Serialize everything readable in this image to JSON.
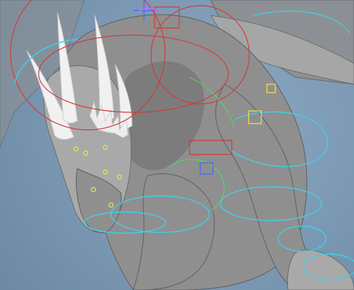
{
  "viewport": {
    "name": "3D viewport",
    "background_color": "#7f9cb6"
  },
  "scene": {
    "subject": "dragon-model",
    "controls_colors": {
      "red": "#d13b3b",
      "cyan": "#3fd0e8",
      "green": "#55d65b",
      "yellow": "#f1e04a",
      "blue": "#4863ff",
      "magenta": "#e263ff"
    },
    "icons": {
      "control-curve": "curve-icon",
      "locator": "cross-icon",
      "joint": "circle-icon"
    }
  }
}
